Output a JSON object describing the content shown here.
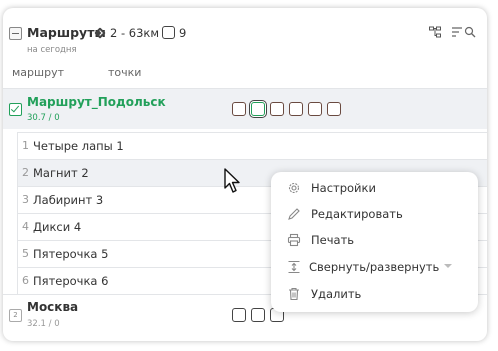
{
  "header": {
    "title": "Маршруты",
    "distance": "2 - 63км",
    "count": "9",
    "subtitle": "на сегодня",
    "tree_icon": "tree-view-icon",
    "filter_icon": "filter-search-icon"
  },
  "columns": {
    "route": "маршрут",
    "points": "точки"
  },
  "routes": [
    {
      "name": "Маршрут_Подольск",
      "sub": "30.7 / 0",
      "checked": true,
      "points": [
        {
          "num": "1",
          "name": "Четыре лапы 1"
        },
        {
          "num": "2",
          "name": "Магнит 2"
        },
        {
          "num": "3",
          "name": "Лабиринт 3"
        },
        {
          "num": "4",
          "name": "Дикси 4"
        },
        {
          "num": "5",
          "name": "Пятерочка 5"
        },
        {
          "num": "6",
          "name": "Пятерочка 6"
        }
      ]
    },
    {
      "num": "2",
      "name": "Москва",
      "sub": "32.1 / 0"
    }
  ],
  "context_menu": {
    "items": [
      {
        "label": "Настройки",
        "icon": "gear-icon"
      },
      {
        "label": "Редактировать",
        "icon": "pencil-icon"
      },
      {
        "label": "Печать",
        "icon": "printer-icon"
      },
      {
        "label": "Свернуть/развернуть",
        "icon": "expand-collapse-icon"
      },
      {
        "label": "Удалить",
        "icon": "trash-icon"
      }
    ]
  },
  "colors": {
    "accent": "#22a05a",
    "row_highlight": "#eff1f4"
  }
}
